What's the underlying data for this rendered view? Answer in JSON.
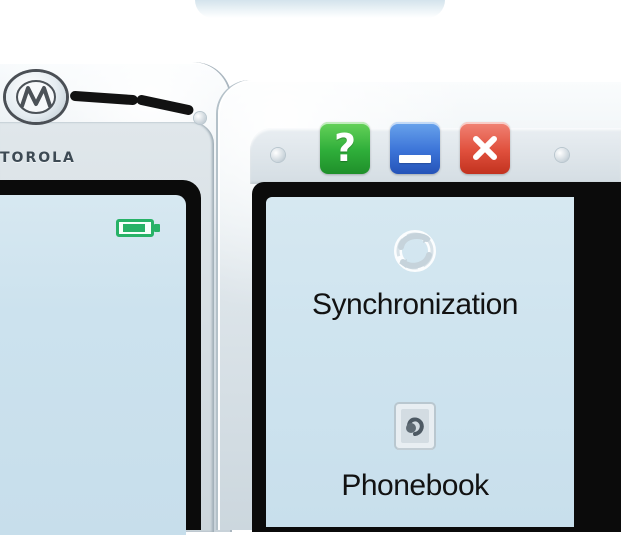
{
  "brand": {
    "logo_icon": "motorola-batwing-logo-icon",
    "wordmark": "TOROLA"
  },
  "status": {
    "battery_icon": "battery-icon"
  },
  "window_controls": {
    "help_label": "?",
    "help_icon": "help-icon",
    "minimize_icon": "minimize-icon",
    "close_icon": "close-icon",
    "help_color": "#35B846",
    "minimize_color": "#3C74D8",
    "close_color": "#E0503D"
  },
  "menu": {
    "items": [
      {
        "label": "Synchronization",
        "icon": "sync-icon"
      },
      {
        "label": "Phonebook",
        "icon": "phonebook-icon"
      }
    ]
  }
}
